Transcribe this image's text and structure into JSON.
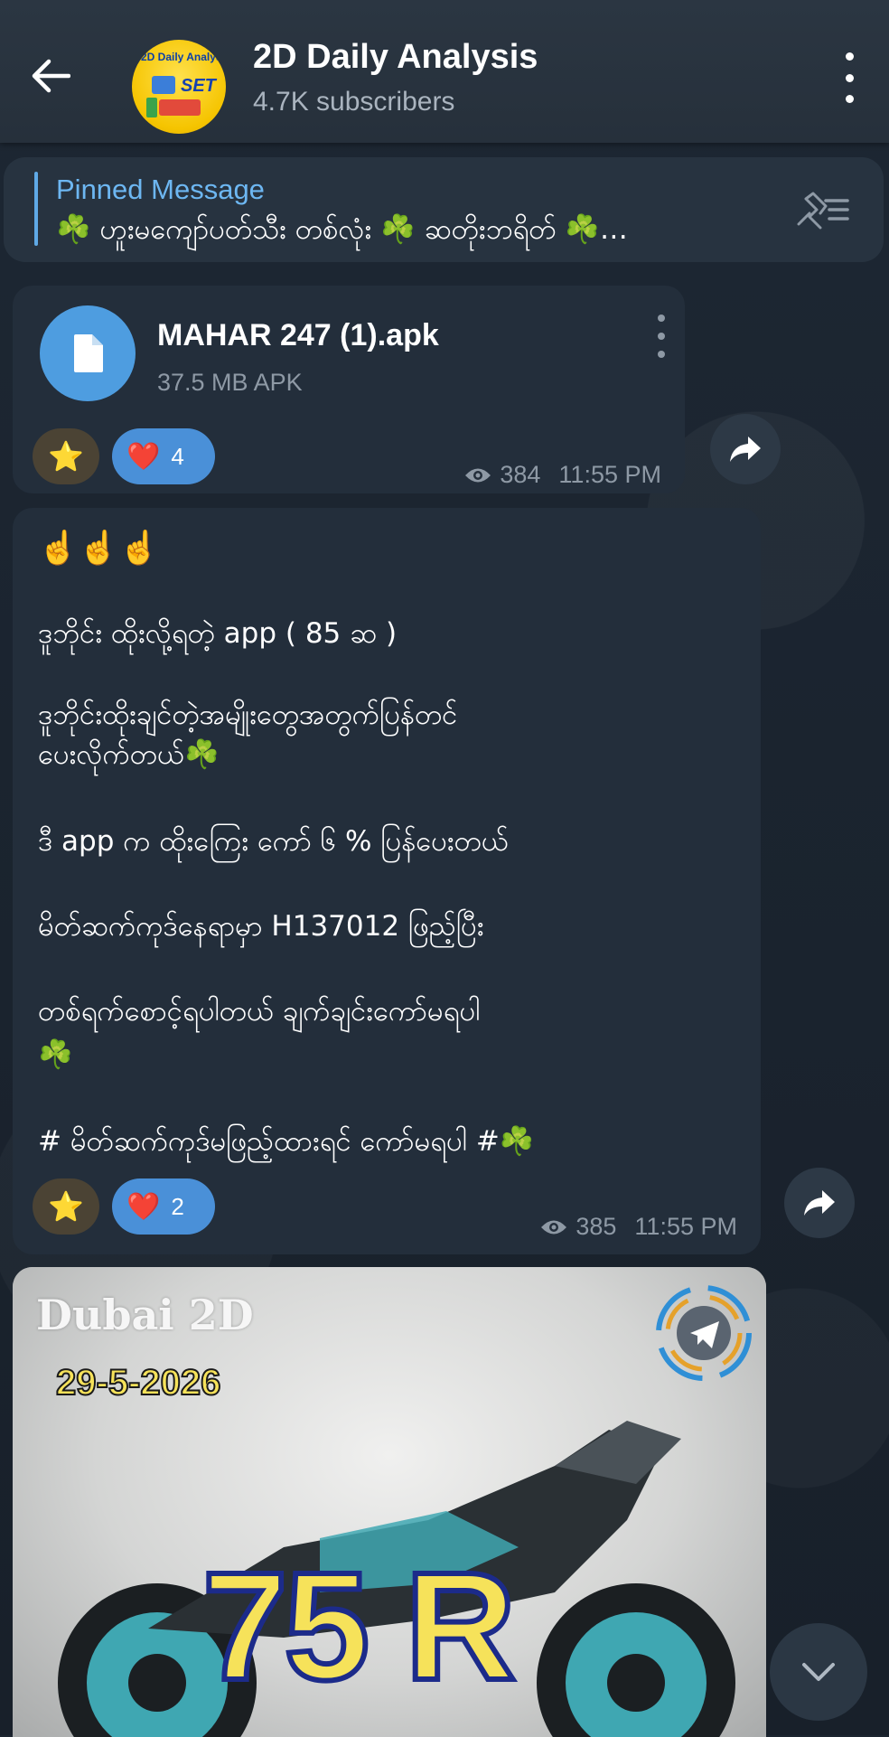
{
  "header": {
    "title": "2D Daily Analysis",
    "subtitle": "4.7K subscribers",
    "avatar_text": "2D Daily Analysis",
    "avatar_tagline": "SET",
    "icons": {
      "back": "arrow-left-icon",
      "menu": "more-vertical-icon"
    }
  },
  "pinned": {
    "label": "Pinned Message",
    "text": "☘️ ဟူးမကျော်ပတ်သီး တစ်လုံး ☘️ ဆတိုးဘရိတ် ☘️…"
  },
  "file_message": {
    "name": "MAHAR 247 (1).apk",
    "size": "37.5 MB APK",
    "reactions": {
      "star": "⭐",
      "heart": "❤️",
      "heart_count": "4"
    },
    "views": "384",
    "time": "11:55 PM"
  },
  "text_message": {
    "lines": [
      "☝️☝️☝️",
      "ဒူဘိုင်း ထိုးလို့ရတဲ့ app ( 85 ဆ )",
      "ဒူဘိုင်းထိုးချင်တဲ့အမျိုးတွေအတွက်ပြန်တင်",
      "ပေးလိုက်တယ်☘️",
      "ဒီ app က ထိုးကြေး ကော် ၆ % ပြန်ပေးတယ်",
      "မိတ်ဆက်ကုဒ်နေရာမှာ H137012 ဖြည့်ပြီး",
      "တစ်ရက်စောင့်ရပါတယ် ချက်ချင်းကော်မရပါ",
      "☘️",
      "# မိတ်ဆက်ကုဒ်မဖြည့်ထားရင် ကော်မရပါ #☘️"
    ],
    "reactions": {
      "star": "⭐",
      "heart": "❤️",
      "heart_count": "2"
    },
    "views": "385",
    "time": "11:55 PM"
  },
  "image_message": {
    "title": "Dubai 2D",
    "date": "29-5-2026",
    "number": "75 R"
  },
  "colors": {
    "background": "#1c2530",
    "header": "#2b3642",
    "bubble": "#232e3b",
    "accent": "#5fa9e6",
    "heart_reaction": "#4a90d8"
  }
}
